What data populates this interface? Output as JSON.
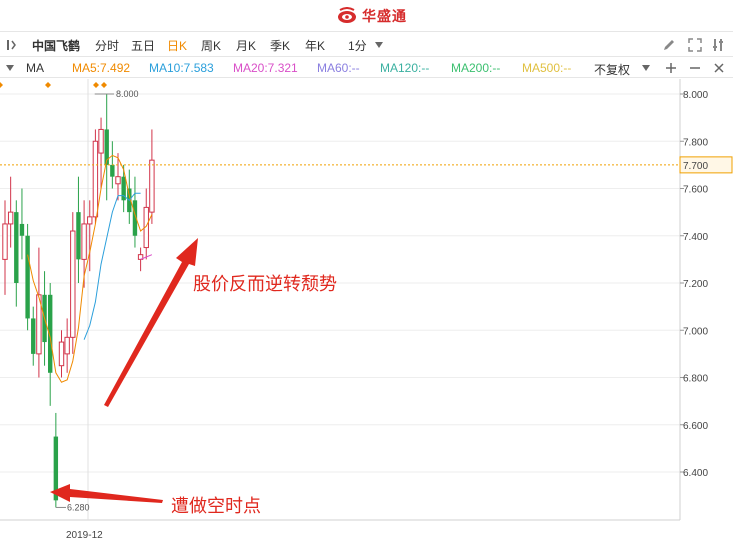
{
  "brand": {
    "name": "华盛通",
    "color": "#d62c2c",
    "icon": "huasheng-logo-icon"
  },
  "toolbar": {
    "stock_name": "中国飞鹤",
    "periods": [
      "分时",
      "五日",
      "日K",
      "周K",
      "月K",
      "季K",
      "年K"
    ],
    "active_period": "日K",
    "minute_select": "1分",
    "icons": [
      "pencil-icon",
      "expand-icon",
      "settings-icon"
    ]
  },
  "ma_bar": {
    "label": "MA",
    "items": [
      {
        "text": "MA5:7.492",
        "color": "#f08a00"
      },
      {
        "text": "MA10:7.583",
        "color": "#2b9fdb"
      },
      {
        "text": "MA20:7.321",
        "color": "#d94fc8"
      },
      {
        "text": "MA60:--",
        "color": "#8a7fe0"
      },
      {
        "text": "MA120:--",
        "color": "#3ab0a0"
      },
      {
        "text": "MA200:--",
        "color": "#3cc070"
      },
      {
        "text": "MA500:--",
        "color": "#e0c040"
      }
    ],
    "adjust": "不复权",
    "icons": [
      "plus-icon",
      "minus-icon",
      "close-icon"
    ]
  },
  "chart_data": {
    "type": "candlestick",
    "y_ticks": [
      "8.000",
      "7.800",
      "7.600",
      "7.400",
      "7.200",
      "7.000",
      "6.800",
      "6.600",
      "6.400"
    ],
    "ylim": [
      6.25,
      8.05
    ],
    "current_price_label": "7.700",
    "current_price": 7.7,
    "x_label": "2019-12",
    "high_marker": "8.000",
    "low_marker": "6.280",
    "annotations": [
      "股价反而逆转颓势",
      "遭做空时点"
    ],
    "candles": [
      {
        "o": 7.3,
        "h": 7.55,
        "l": 7.15,
        "c": 7.45
      },
      {
        "o": 7.45,
        "h": 7.65,
        "l": 7.35,
        "c": 7.5
      },
      {
        "o": 7.5,
        "h": 7.55,
        "l": 7.1,
        "c": 7.2
      },
      {
        "o": 7.45,
        "h": 7.6,
        "l": 7.3,
        "c": 7.4
      },
      {
        "o": 7.4,
        "h": 7.45,
        "l": 7.0,
        "c": 7.05
      },
      {
        "o": 7.05,
        "h": 7.1,
        "l": 6.85,
        "c": 6.9
      },
      {
        "o": 6.9,
        "h": 7.35,
        "l": 6.8,
        "c": 7.15
      },
      {
        "o": 7.15,
        "h": 7.25,
        "l": 6.85,
        "c": 6.95
      },
      {
        "o": 7.15,
        "h": 7.2,
        "l": 6.68,
        "c": 6.82
      },
      {
        "o": 6.55,
        "h": 6.65,
        "l": 6.25,
        "c": 6.28
      },
      {
        "o": 6.85,
        "h": 7.0,
        "l": 6.8,
        "c": 6.95
      },
      {
        "o": 6.9,
        "h": 7.05,
        "l": 6.82,
        "c": 6.97
      },
      {
        "o": 6.97,
        "h": 7.5,
        "l": 6.9,
        "c": 7.42
      },
      {
        "o": 7.5,
        "h": 7.65,
        "l": 7.2,
        "c": 7.3
      },
      {
        "o": 7.3,
        "h": 7.55,
        "l": 7.18,
        "c": 7.45
      },
      {
        "o": 7.45,
        "h": 7.55,
        "l": 7.25,
        "c": 7.48
      },
      {
        "o": 7.48,
        "h": 7.85,
        "l": 7.45,
        "c": 7.8
      },
      {
        "o": 7.75,
        "h": 7.9,
        "l": 7.6,
        "c": 7.85
      },
      {
        "o": 7.85,
        "h": 8.0,
        "l": 7.55,
        "c": 7.7
      },
      {
        "o": 7.7,
        "h": 7.8,
        "l": 7.6,
        "c": 7.65
      },
      {
        "o": 7.62,
        "h": 7.75,
        "l": 7.55,
        "c": 7.65
      },
      {
        "o": 7.65,
        "h": 7.7,
        "l": 7.5,
        "c": 7.55
      },
      {
        "o": 7.6,
        "h": 7.68,
        "l": 7.45,
        "c": 7.5
      },
      {
        "o": 7.55,
        "h": 7.65,
        "l": 7.35,
        "c": 7.4
      },
      {
        "o": 7.3,
        "h": 7.35,
        "l": 7.25,
        "c": 7.32
      },
      {
        "o": 7.35,
        "h": 7.6,
        "l": 7.3,
        "c": 7.52
      },
      {
        "o": 7.5,
        "h": 7.85,
        "l": 7.45,
        "c": 7.72
      }
    ],
    "ma5": [
      null,
      null,
      null,
      null,
      7.32,
      7.21,
      7.14,
      7.05,
      6.97,
      6.82,
      6.78,
      6.79,
      6.87,
      7.01,
      7.23,
      7.33,
      7.45,
      7.6,
      7.72,
      7.74,
      7.73,
      7.68,
      7.57,
      7.49,
      7.42,
      7.44,
      7.49
    ],
    "ma10": [
      null,
      null,
      null,
      null,
      null,
      null,
      null,
      null,
      null,
      null,
      null,
      null,
      null,
      null,
      6.96,
      7.02,
      7.12,
      7.28,
      7.39,
      7.5,
      7.57,
      7.57,
      7.55,
      7.58,
      7.58
    ],
    "ma20": [
      null,
      null,
      null,
      null,
      null,
      null,
      null,
      null,
      null,
      null,
      null,
      null,
      null,
      null,
      null,
      null,
      null,
      null,
      null,
      null,
      null,
      null,
      null,
      null,
      7.3,
      7.31,
      7.32
    ]
  }
}
